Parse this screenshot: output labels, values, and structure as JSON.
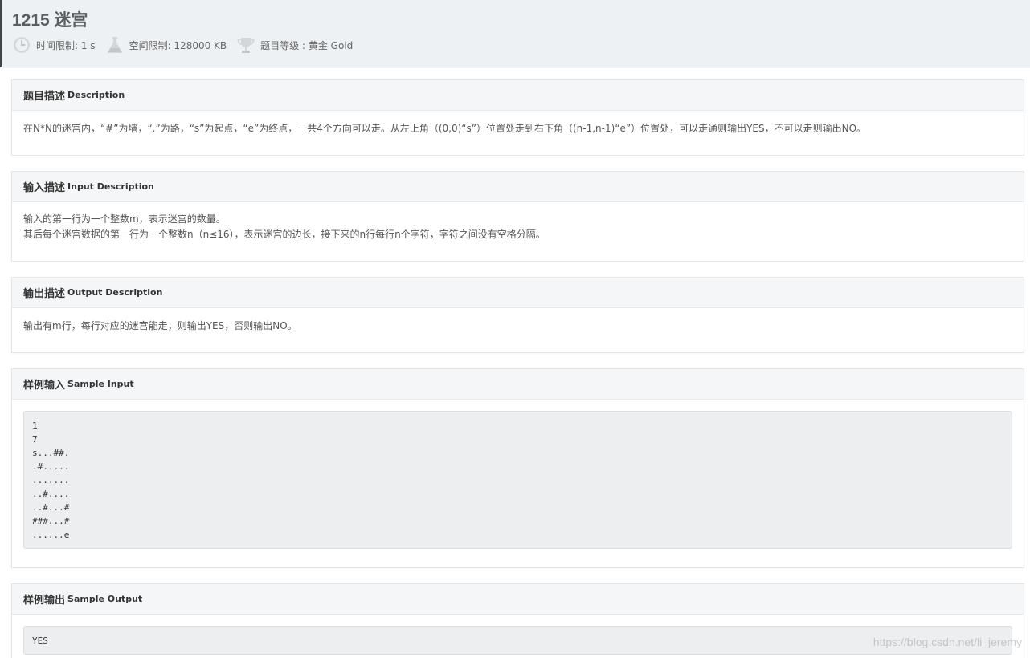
{
  "problem": {
    "title": "1215 迷宫",
    "time_limit": "时间限制: 1 s",
    "memory_limit": "空间限制: 128000 KB",
    "level": "题目等级 : 黄金 Gold"
  },
  "sections": {
    "description": {
      "title_cn": "题目描述",
      "title_en": "Description",
      "text": "在N*N的迷宫内，“#”为墙，“.”为路，“s”为起点，“e”为终点，一共4个方向可以走。从左上角（(0,0)“s”）位置处走到右下角（(n-1,n-1)“e”）位置处，可以走通则输出YES，不可以走则输出NO。"
    },
    "input": {
      "title_cn": "输入描述",
      "title_en": "Input Description",
      "line1": "输入的第一行为一个整数m，表示迷宫的数量。",
      "line2": "其后每个迷宫数据的第一行为一个整数n（n≤16），表示迷宫的边长，接下来的n行每行n个字符，字符之间没有空格分隔。"
    },
    "output": {
      "title_cn": "输出描述",
      "title_en": "Output Description",
      "text": "输出有m行，每行对应的迷宫能走，则输出YES，否则输出NO。"
    },
    "sample_input": {
      "title_cn": "样例输入",
      "title_en": "Sample Input",
      "code": "1\n7\ns...##.\n.#.....\n.......\n..#....\n..#...#\n###...#\n......e"
    },
    "sample_output": {
      "title_cn": "样例输出",
      "title_en": "Sample Output",
      "code": "YES"
    }
  },
  "watermark": "https://blog.csdn.net/li_jeremy",
  "icons": {
    "time": "clock-icon",
    "memory": "flask-icon",
    "level": "trophy-icon"
  },
  "colors": {
    "header_bg": "#eef1f3",
    "panel_head_bg": "#f5f6f7",
    "code_bg": "#eceeef",
    "icon_gray": "#c9cccf"
  }
}
